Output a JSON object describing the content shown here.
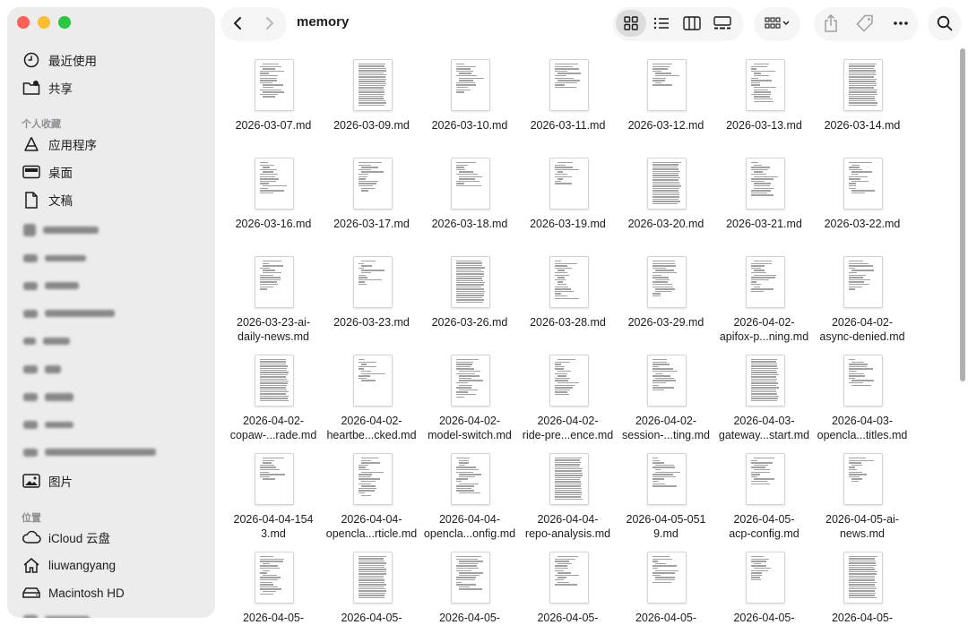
{
  "window": {
    "title": "memory"
  },
  "colors": {
    "close": "#ff5f57",
    "minimize": "#febc2e",
    "zoom": "#28c840"
  },
  "sidebar": {
    "top_items": [
      {
        "label": "最近使用",
        "icon": "clock-icon"
      },
      {
        "label": "共享",
        "icon": "shared-folder-icon"
      }
    ],
    "favorites_header": "个人收藏",
    "favorites": [
      {
        "label": "应用程序",
        "icon": "applications-icon"
      },
      {
        "label": "桌面",
        "icon": "desktop-icon"
      },
      {
        "label": "文稿",
        "icon": "document-icon"
      }
    ],
    "pictures_label": "图片",
    "locations_header": "位置",
    "locations": [
      {
        "label": "iCloud 云盘",
        "icon": "cloud-icon"
      },
      {
        "label": "liuwangyang",
        "icon": "home-icon"
      },
      {
        "label": "Macintosh HD",
        "icon": "disk-icon"
      }
    ]
  },
  "toolbar": {
    "back": "back-icon",
    "forward": "forward-icon",
    "views": [
      "icon-view",
      "list-view",
      "column-view",
      "gallery-view"
    ],
    "actions": [
      "share-icon",
      "tag-icon",
      "more-icon"
    ],
    "search": "search-icon"
  },
  "files": [
    "2026-03-07.md",
    "2026-03-09.md",
    "2026-03-10.md",
    "2026-03-11.md",
    "2026-03-12.md",
    "2026-03-13.md",
    "2026-03-14.md",
    "2026-03-16.md",
    "2026-03-17.md",
    "2026-03-18.md",
    "2026-03-19.md",
    "2026-03-20.md",
    "2026-03-21.md",
    "2026-03-22.md",
    "2026-03-23-ai-\ndaily-news.md",
    "2026-03-23.md",
    "2026-03-26.md",
    "2026-03-28.md",
    "2026-03-29.md",
    "2026-04-02-\napifox-p...ning.md",
    "2026-04-02-\nasync-denied.md",
    "2026-04-02-\ncopaw-...rade.md",
    "2026-04-02-\nheartbe...cked.md",
    "2026-04-02-\nmodel-switch.md",
    "2026-04-02-\nride-pre...ence.md",
    "2026-04-02-\nsession-...ting.md",
    "2026-04-03-\ngateway...start.md",
    "2026-04-03-\nopencla...titles.md",
    "2026-04-04-154\n3.md",
    "2026-04-04-\nopencla...rticle.md",
    "2026-04-04-\nopencla...onfig.md",
    "2026-04-04-\nrepo-analysis.md",
    "2026-04-05-051\n9.md",
    "2026-04-05-\nacp-config.md",
    "2026-04-05-ai-\nnews.md",
    "2026-04-05-",
    "2026-04-05-",
    "2026-04-05-",
    "2026-04-05-",
    "2026-04-05-",
    "2026-04-05-",
    "2026-04-05-"
  ]
}
